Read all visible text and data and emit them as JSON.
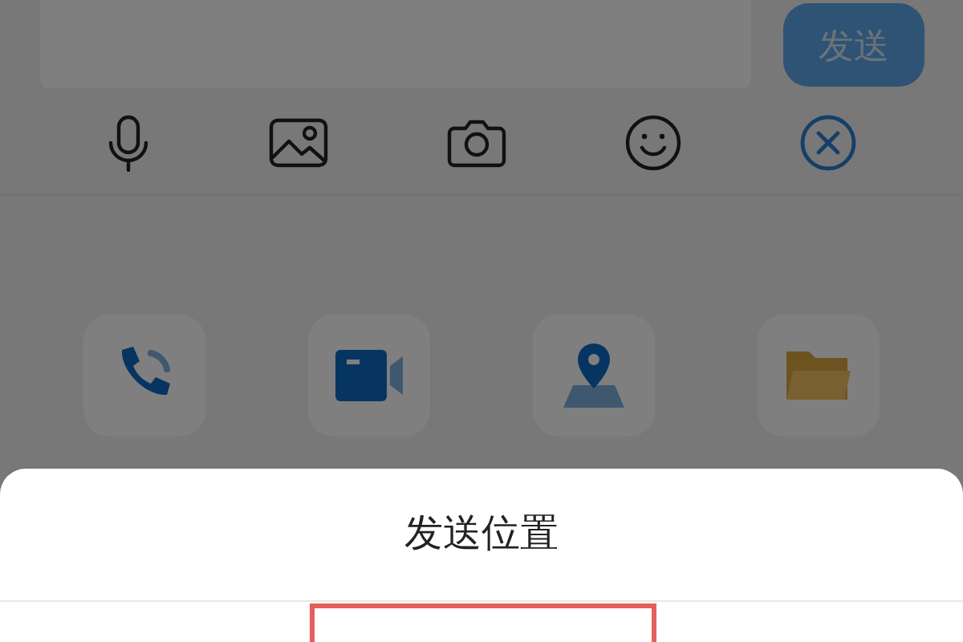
{
  "composer": {
    "send_button": "发送"
  },
  "toolbar": [
    {
      "kind": "voice"
    },
    {
      "kind": "image"
    },
    {
      "kind": "camera"
    },
    {
      "kind": "emoji"
    },
    {
      "kind": "close"
    }
  ],
  "actions": [
    {
      "kind": "phone"
    },
    {
      "kind": "video"
    },
    {
      "kind": "location"
    },
    {
      "kind": "folder"
    }
  ],
  "sheet": {
    "title": "发送位置"
  }
}
